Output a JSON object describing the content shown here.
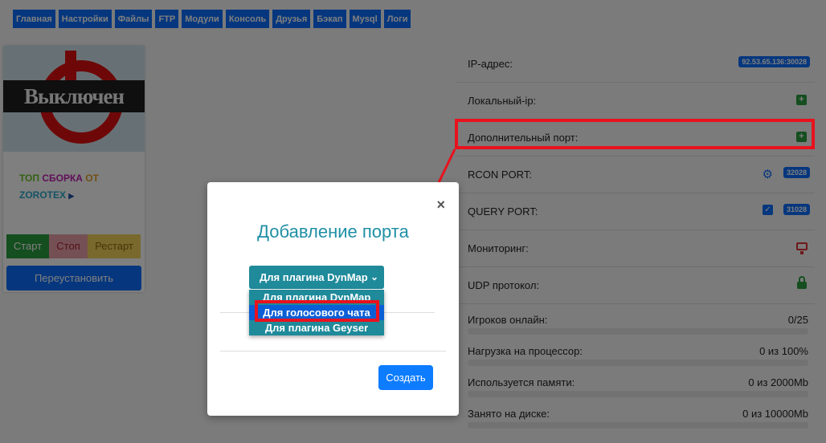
{
  "nav": [
    "Главная",
    "Настройки",
    "Файлы",
    "FTP",
    "Модули",
    "Консоль",
    "Друзья",
    "Бэкап",
    "Mysql",
    "Логи"
  ],
  "server": {
    "status_text": "Выключен",
    "promo": [
      "ТОП ",
      "СБОРКА ",
      "ОТ",
      "ZOROTEX"
    ],
    "buttons": {
      "start": "Старт",
      "stop": "Стоп",
      "restart": "Рестарт",
      "reinstall": "Переустановить"
    }
  },
  "info": {
    "ip_label": "IP-адрес:",
    "ip_value": "92.53.65.136:30028",
    "local_ip_label": "Локальный-ip:",
    "extra_port_label": "Дополнительный порт:",
    "rcon_label": "RCON PORT:",
    "rcon_value": "32028",
    "query_label": "QUERY PORT:",
    "query_value": "31028",
    "monitoring_label": "Мониторинг:",
    "udp_label": "UDP протокол:",
    "players_label": "Игроков онлайн:",
    "players_value": "0/25",
    "cpu_label": "Нагрузка на процессор:",
    "cpu_value": "0 из 100%",
    "ram_label": "Используется памяти:",
    "ram_value": "0 из 2000Mb",
    "disk_label": "Занято на диске:",
    "disk_value": "0 из 10000Mb",
    "plus_symbol": "+"
  },
  "modal": {
    "close": "×",
    "title": "Добавление порта",
    "selected": "Для плагина DynMap",
    "options": [
      "Для плагина DynMap",
      "Для голосового чата",
      "Для плагина Geyser"
    ],
    "highlighted_index": 1,
    "create_label": "Создать"
  },
  "colors": {
    "accent": "#0d6efd",
    "annotation": "#e8121e",
    "select_bg": "#1f8a9a"
  }
}
